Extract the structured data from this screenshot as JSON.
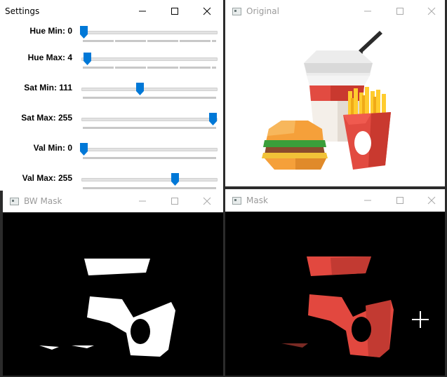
{
  "windows": {
    "settings": {
      "title": "Settings"
    },
    "original": {
      "title": "Original"
    },
    "bw_mask": {
      "title": "BW Mask"
    },
    "mask": {
      "title": "Mask"
    }
  },
  "sliders": [
    {
      "label": "Hue Min: 0",
      "value": 0,
      "max": 179
    },
    {
      "label": "Hue Max: 4",
      "value": 4,
      "max": 179
    },
    {
      "label": "Sat Min: 111",
      "value": 111,
      "max": 255
    },
    {
      "label": "Sat Max: 255",
      "value": 255,
      "max": 255
    },
    {
      "label": "Val Min: 0",
      "value": 0,
      "max": 255
    },
    {
      "label": "Val Max: 255",
      "value": 255,
      "max": 255
    }
  ],
  "colors": {
    "accent": "#0078d7",
    "mask_red": "#e2483f"
  },
  "icons": [
    "minimize-icon",
    "maximize-icon",
    "close-icon",
    "app-icon",
    "crosshair-cursor-icon"
  ]
}
